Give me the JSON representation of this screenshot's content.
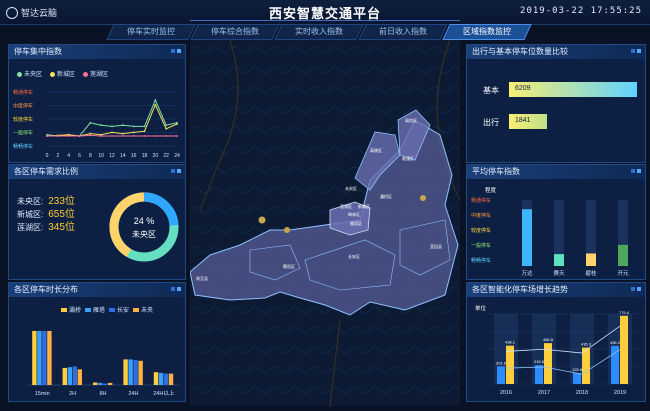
{
  "brand": {
    "name": "智达云脑"
  },
  "header": {
    "title": "西安智慧交通平台",
    "datetime": "2019-03-22  17:55:25"
  },
  "tabs": [
    {
      "label": "停车实时监控",
      "active": false
    },
    {
      "label": "停车综合指数",
      "active": false
    },
    {
      "label": "实时收入指数",
      "active": false
    },
    {
      "label": "前日收入指数",
      "active": false
    },
    {
      "label": "区域指数监控",
      "active": true
    }
  ],
  "panels": {
    "concentration": {
      "title": "停车集中指数",
      "legend": [
        "未央区",
        "新城区",
        "莲湖区"
      ],
      "y_labels": [
        "畅通停车",
        "中度停车",
        "较度停车",
        "一般停车",
        "畅畅停车"
      ],
      "x_labels": [
        "0",
        "2",
        "4",
        "6",
        "8",
        "10",
        "12",
        "14",
        "16",
        "18",
        "20",
        "22",
        "24"
      ]
    },
    "demand": {
      "title": "各区停车需求比例",
      "stats": [
        {
          "label": "未央区:",
          "value": "233位"
        },
        {
          "label": "新城区:",
          "value": "655位"
        },
        {
          "label": "莲湖区:",
          "value": "345位"
        }
      ],
      "donut": {
        "percent": "24 %",
        "label": "未央区",
        "fraction": 0.24
      }
    },
    "duration": {
      "title": "各区停车时长分布",
      "legend": [
        "灞桥",
        "雁塔",
        "长安",
        "未央"
      ],
      "categories": [
        "15min",
        "2H",
        "8H",
        "24H",
        "24H以上"
      ]
    },
    "compare": {
      "title": "出行与基本停车位数量比较",
      "bars": [
        {
          "label": "基本",
          "value": "6209",
          "fraction": 1.0
        },
        {
          "label": "出行",
          "value": "1841",
          "fraction": 0.3
        }
      ]
    },
    "avgindex": {
      "title": "平均停车指数",
      "ylabel": "程度",
      "y_labels": [
        "畅通停车",
        "中度停车",
        "较度停车",
        "一般停车",
        "畅畅停车"
      ],
      "categories": [
        "万达",
        "赛天",
        "碧桂",
        "开元"
      ]
    },
    "growth": {
      "title": "各区智能化停车场增长趋势",
      "ylabel": "单位",
      "years": [
        "2016",
        "2017",
        "2018",
        "2019"
      ],
      "labels": [
        "438.1",
        "466.8",
        "201.6",
        "779.4",
        "436.2",
        "215.6",
        "416.3",
        "125.9"
      ]
    }
  },
  "map": {
    "districts": [
      "阎良区",
      "临潼区",
      "高陵区",
      "未央区",
      "灞桥区",
      "莲湖区",
      "新城区",
      "碑林区",
      "雁塔区",
      "长安区",
      "周至县",
      "鄠邑区",
      "蓝田县"
    ]
  },
  "chart_data": [
    {
      "type": "line",
      "title": "停车集中指数",
      "x": [
        0,
        2,
        4,
        6,
        8,
        10,
        12,
        14,
        16,
        18,
        20,
        22,
        24
      ],
      "series": [
        {
          "name": "未央区",
          "color": "#7fe3a2",
          "values": [
            1.1,
            1.0,
            1.1,
            1.0,
            2.1,
            1.9,
            1.8,
            1.9,
            1.8,
            1.8,
            4.0,
            1.9,
            2.1
          ]
        },
        {
          "name": "新城区",
          "color": "#f5e25a",
          "values": [
            1.0,
            1.05,
            1.1,
            1.0,
            1.2,
            1.1,
            1.3,
            1.2,
            1.3,
            1.4,
            3.6,
            1.6,
            2.0
          ]
        },
        {
          "name": "莲湖区",
          "color": "#ff6f9e",
          "values": [
            1.0,
            1.0,
            1.0,
            1.0,
            1.05,
            1.0,
            1.0,
            1.0,
            1.0,
            1.0,
            1.0,
            1.0,
            1.0
          ]
        }
      ],
      "ylim": [
        0,
        5
      ]
    },
    {
      "type": "bar",
      "title": "各区停车时长分布",
      "categories": [
        "15min",
        "2H",
        "8H",
        "24H",
        "24H以上"
      ],
      "series": [
        {
          "name": "灞桥",
          "color": "#ffce3d",
          "values": [
            380,
            120,
            18,
            180,
            90
          ]
        },
        {
          "name": "雁塔",
          "color": "#3aa0ff",
          "values": [
            380,
            125,
            15,
            180,
            85
          ]
        },
        {
          "name": "长安",
          "color": "#2d6fe0",
          "values": [
            380,
            130,
            10,
            175,
            80
          ]
        },
        {
          "name": "未央",
          "color": "#ffb23d",
          "values": [
            380,
            110,
            15,
            170,
            80
          ]
        }
      ],
      "ylim": [
        0,
        450
      ]
    },
    {
      "type": "bar",
      "title": "平均停车指数",
      "categories": [
        "万达",
        "赛天",
        "碧桂",
        "开元"
      ],
      "values": [
        4.3,
        0.9,
        0.95,
        1.6
      ],
      "colors": [
        "#3fb4ff",
        "#5fe2c2",
        "#ffd36b",
        "#4ea85a"
      ],
      "ylim": [
        0,
        5
      ]
    },
    {
      "type": "bar",
      "title": "各区智能化停车场增长趋势",
      "categories": [
        "2016",
        "2017",
        "2018",
        "2019"
      ],
      "series": [
        {
          "name": "A",
          "color": "#2d8cff",
          "values": [
            201.6,
            215.6,
            125.9,
            436.2
          ]
        },
        {
          "name": "B",
          "color": "#ffce3d",
          "values": [
            438.1,
            466.8,
            416.3,
            779.4
          ]
        }
      ],
      "ylim": [
        0,
        800
      ]
    }
  ]
}
